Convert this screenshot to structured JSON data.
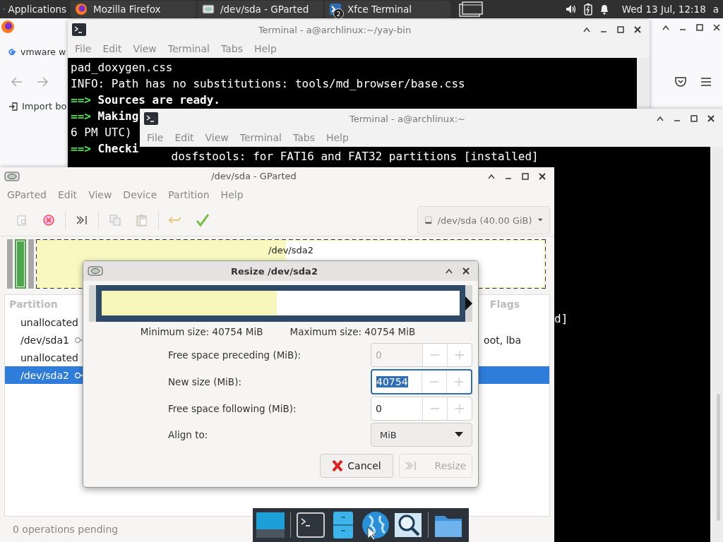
{
  "panel": {
    "apps_label": "Applications",
    "tasks": [
      {
        "label": "Mozilla Firefox",
        "kind": "firefox"
      },
      {
        "label": "/dev/sda - GParted",
        "kind": "gparted"
      },
      {
        "label": "Xfce Terminal",
        "kind": "terminal",
        "badge": "2"
      }
    ],
    "clock": "Wed 13 Jul, 12:18",
    "user": "a"
  },
  "browser": {
    "tab_title": "vmware w",
    "bookmark": "Import bo"
  },
  "terminals": [
    {
      "title": "Terminal - a@archlinux:~/yay-bin",
      "menu": [
        "File",
        "Edit",
        "View",
        "Terminal",
        "Tabs",
        "Help"
      ],
      "lines": [
        {
          "text": "pad_doxygen.css"
        },
        {
          "text": "INFO: Path has no substitutions: tools/md_browser/base.css"
        },
        {
          "prompt": "==>",
          "text": "Sources are ready."
        },
        {
          "prompt": "==>",
          "text": "Making"
        },
        {
          "text": "6 PM UTC)"
        },
        {
          "prompt": "==>",
          "text": "Checki"
        }
      ]
    },
    {
      "title": "Terminal - a@archlinux:~",
      "menu": [
        "File",
        "Edit",
        "View",
        "Terminal",
        "Tabs",
        "Help"
      ],
      "lines": [
        {
          "text": "    dosfstools: for FAT16 and FAT32 partitions [installed]"
        },
        {
          "text": "d]",
          "kind": "fragment"
        }
      ]
    }
  ],
  "gparted": {
    "title": "/dev/sda - GParted",
    "menu": [
      "GParted",
      "Edit",
      "View",
      "Device",
      "Partition",
      "Help"
    ],
    "device": "/dev/sda (40.00 GiB)",
    "graph": {
      "label": "/dev/sda2",
      "level": 0.49
    },
    "columns": [
      "Partition",
      "Flags"
    ],
    "rows": [
      {
        "partition": "unallocated",
        "selected": false
      },
      {
        "partition": "/dev/sda1",
        "flags": "oot, lba",
        "key": true,
        "selected": false
      },
      {
        "partition": "unallocated",
        "selected": false
      },
      {
        "partition": "/dev/sda2",
        "key": true,
        "selected": true
      }
    ],
    "status": "0 operations pending"
  },
  "resize_dialog": {
    "title": "Resize /dev/sda2",
    "level": 0.49,
    "min_size": "Minimum size: 40754 MiB",
    "max_size": "Maximum size: 40754 MiB",
    "fields": [
      {
        "label": "Free space preceding (MiB):",
        "value": "0",
        "disabled": true,
        "focused": false
      },
      {
        "label": "New size (MiB):",
        "value": "40754",
        "disabled": false,
        "focused": true
      },
      {
        "label": "Free space following (MiB):",
        "value": "0",
        "disabled": false,
        "focused": false
      }
    ],
    "align": {
      "label": "Align to:",
      "value": "MiB"
    },
    "buttons": [
      {
        "label": "Cancel",
        "kind": "cancel",
        "disabled": false
      },
      {
        "label": "Resize",
        "kind": "resize",
        "disabled": true
      }
    ]
  }
}
